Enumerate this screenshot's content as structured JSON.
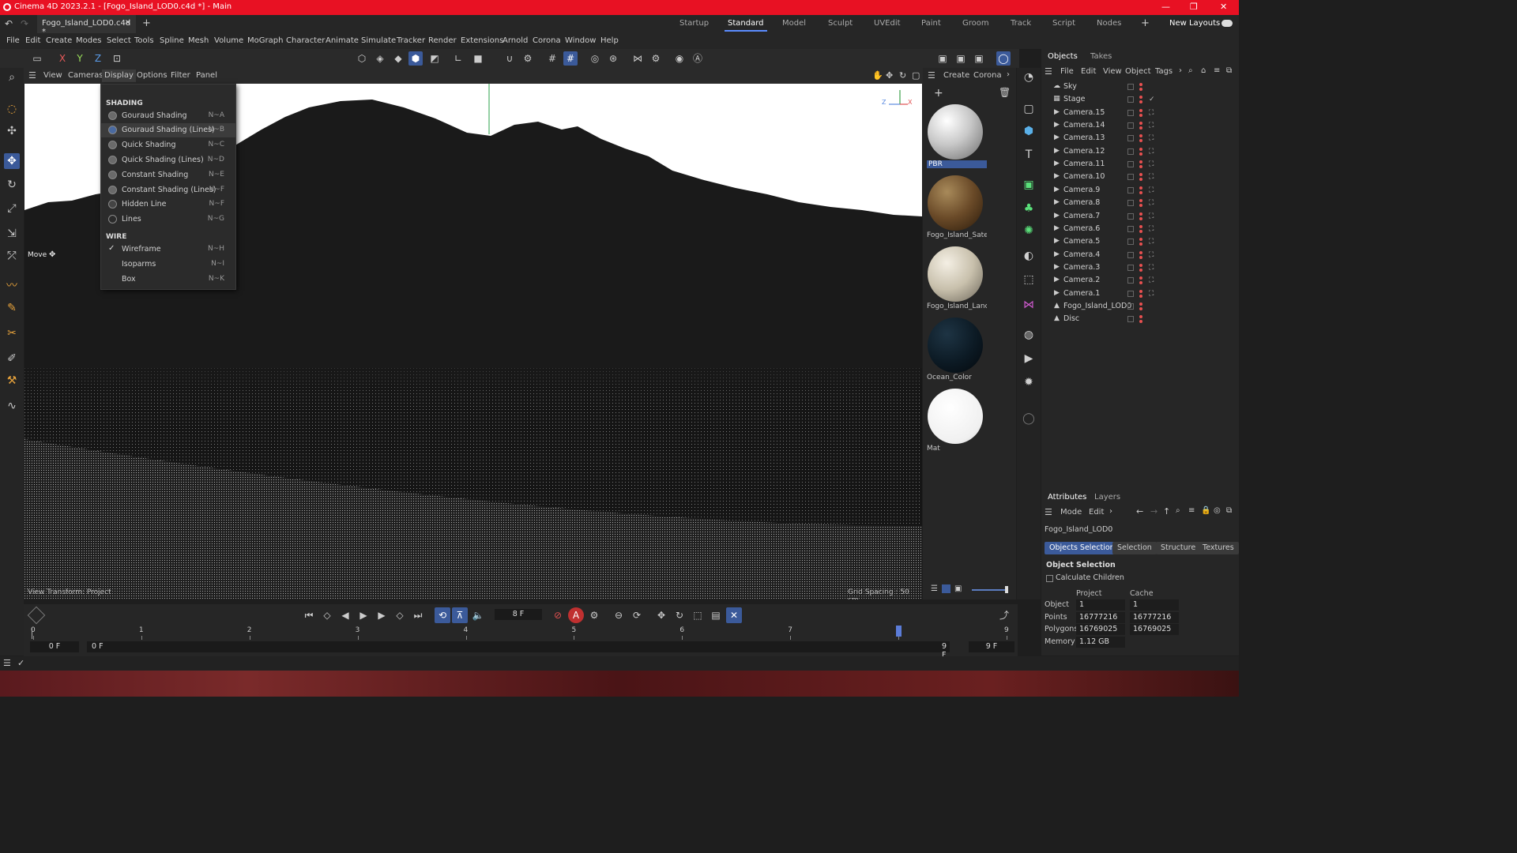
{
  "window": {
    "title": "Cinema 4D 2023.2.1 - [Fogo_Island_LOD0.c4d *] - Main",
    "controls": [
      "—",
      "❐",
      "✕"
    ]
  },
  "file_tab": {
    "name": "Fogo_Island_LOD0.c4d *",
    "close": "×",
    "add": "+"
  },
  "layouts": [
    "Startup",
    "Standard",
    "Model",
    "Sculpt",
    "UVEdit",
    "Paint",
    "Groom",
    "Track",
    "Script",
    "Nodes"
  ],
  "layouts_active": "Standard",
  "new_layouts": "New Layouts",
  "menubar": [
    "File",
    "Edit",
    "Create",
    "Modes",
    "Select",
    "Tools",
    "Spline",
    "Mesh",
    "Volume",
    "MoGraph",
    "Character",
    "Animate",
    "Simulate",
    "Tracker",
    "Render",
    "Extensions",
    "Arnold",
    "Corona",
    "Window",
    "Help"
  ],
  "axis_buttons": [
    "X",
    "Y",
    "Z"
  ],
  "viewport_menu": [
    "View",
    "Cameras",
    "Display",
    "Options",
    "Filter",
    "Panel"
  ],
  "viewport_menu_selected": "Display",
  "viewport": {
    "move_label": "Move",
    "transform_label": "View Transform: Project",
    "grid_spacing": "Grid Spacing : 50 cm",
    "axis": {
      "z": "Z",
      "x": "X"
    }
  },
  "display_menu": {
    "shading_header": "SHADING",
    "shading_items": [
      {
        "label": "Gouraud Shading",
        "key": "N~A"
      },
      {
        "label": "Gouraud Shading (Lines)",
        "key": "N~B"
      },
      {
        "label": "Quick Shading",
        "key": "N~C"
      },
      {
        "label": "Quick Shading (Lines)",
        "key": "N~D"
      },
      {
        "label": "Constant Shading",
        "key": "N~E"
      },
      {
        "label": "Constant Shading (Lines)",
        "key": "N~F"
      },
      {
        "label": "Hidden Line",
        "key": "N~F"
      },
      {
        "label": "Lines",
        "key": "N~G"
      }
    ],
    "wire_header": "WIRE",
    "wire_items": [
      {
        "label": "Wireframe",
        "key": "N~H",
        "checked": true
      },
      {
        "label": "Isoparms",
        "key": "N~I",
        "checked": false
      },
      {
        "label": "Box",
        "key": "N~K",
        "checked": false
      }
    ]
  },
  "material_panel": {
    "menu": [
      "Create",
      "Corona"
    ],
    "materials": [
      {
        "name": "PBR",
        "selected": true,
        "color": "#d8d8d8"
      },
      {
        "name": "Fogo_Island_Satel",
        "selected": false,
        "color": "#7a5a30"
      },
      {
        "name": "Fogo_Island_Land",
        "selected": false,
        "color": "#c8c0b0"
      },
      {
        "name": "Ocean_Color",
        "selected": false,
        "color": "#0c1a24"
      },
      {
        "name": "Mat",
        "selected": false,
        "color": "#ffffff"
      }
    ]
  },
  "objects_panel": {
    "tabs": [
      "Objects",
      "Takes"
    ],
    "menu": [
      "File",
      "Edit",
      "View",
      "Object",
      "Tags"
    ],
    "objects": [
      {
        "name": "Sky",
        "icon": "sky-icon"
      },
      {
        "name": "Stage",
        "icon": "stage-icon"
      },
      {
        "name": "Camera.15",
        "icon": "camera-icon"
      },
      {
        "name": "Camera.14",
        "icon": "camera-icon"
      },
      {
        "name": "Camera.13",
        "icon": "camera-icon"
      },
      {
        "name": "Camera.12",
        "icon": "camera-icon"
      },
      {
        "name": "Camera.11",
        "icon": "camera-icon"
      },
      {
        "name": "Camera.10",
        "icon": "camera-icon"
      },
      {
        "name": "Camera.9",
        "icon": "camera-icon"
      },
      {
        "name": "Camera.8",
        "icon": "camera-icon"
      },
      {
        "name": "Camera.7",
        "icon": "camera-icon"
      },
      {
        "name": "Camera.6",
        "icon": "camera-icon"
      },
      {
        "name": "Camera.5",
        "icon": "camera-icon"
      },
      {
        "name": "Camera.4",
        "icon": "camera-icon"
      },
      {
        "name": "Camera.3",
        "icon": "camera-icon"
      },
      {
        "name": "Camera.2",
        "icon": "camera-icon"
      },
      {
        "name": "Camera.1",
        "icon": "camera-icon"
      },
      {
        "name": "Fogo_Island_LOD0",
        "icon": "polygon-icon"
      },
      {
        "name": "Disc",
        "icon": "polygon-icon"
      }
    ]
  },
  "attributes_panel": {
    "tabs": [
      "Attributes",
      "Layers"
    ],
    "menu": [
      "Mode",
      "Edit"
    ],
    "object_name": "Fogo_Island_LOD0",
    "sub_tabs": [
      "Objects Selection",
      "Selection",
      "Structure",
      "Textures"
    ],
    "section_title": "Object Selection",
    "calc_children": "Calculate Children",
    "col_headers": [
      "Project",
      "Cache"
    ],
    "rows": [
      {
        "label": "Object",
        "project": "1",
        "cache": "1"
      },
      {
        "label": "Points",
        "project": "16777216",
        "cache": "16777216"
      },
      {
        "label": "Polygons",
        "project": "16769025",
        "cache": "16769025"
      },
      {
        "label": "Memory",
        "project": "1.12 GB",
        "cache": ""
      }
    ]
  },
  "timeline": {
    "current_frame": "8 F",
    "start_field": "0 F",
    "start_field2": "0 F",
    "end_field": "9 F",
    "end_field2": "9 F",
    "ruler": [
      "0",
      "1",
      "2",
      "3",
      "4",
      "5",
      "6",
      "7",
      "8",
      "9"
    ],
    "playhead": 8
  },
  "colors": {
    "titlebar": "#e81123",
    "accent": "#3b5a9a"
  }
}
